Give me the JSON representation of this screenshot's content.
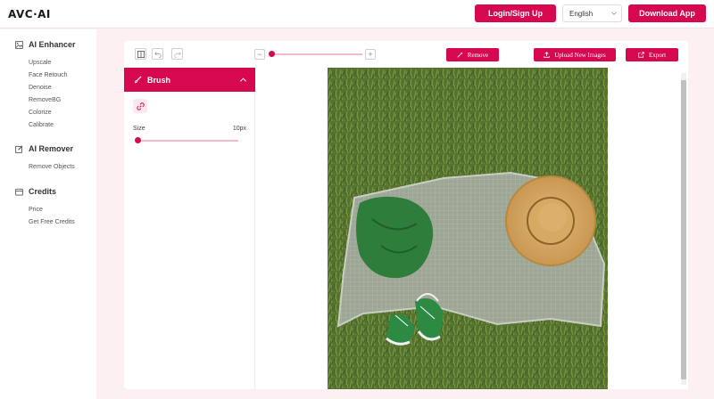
{
  "header": {
    "logo": "AVC·AI",
    "login_label": "Login/Sign Up",
    "language": "English",
    "download_label": "Download App"
  },
  "sidebar": {
    "sections": [
      {
        "title": "AI Enhancer",
        "icon": "image-icon",
        "items": [
          "Upscale",
          "Face Retouch",
          "Denoise",
          "RemoveBG",
          "Colorize",
          "Calibrate"
        ]
      },
      {
        "title": "AI Remover",
        "icon": "edit-icon",
        "items": [
          "Remove Objects"
        ]
      },
      {
        "title": "Credits",
        "icon": "credits-icon",
        "items": [
          "Price",
          "Get Free Credits"
        ]
      }
    ]
  },
  "toolbar": {
    "remove_label": "Remove",
    "upload_label": "Upload New Images",
    "export_label": "Export",
    "zoom_minus": "−",
    "zoom_plus": "+",
    "zoom_level": 0.02
  },
  "brush": {
    "title": "Brush",
    "size_label": "Size",
    "size_value": "10px",
    "size_fraction": 0.0
  },
  "colors": {
    "accent": "#d6084f",
    "accent_light": "#f2b9cb",
    "background": "#fdf0f3"
  }
}
